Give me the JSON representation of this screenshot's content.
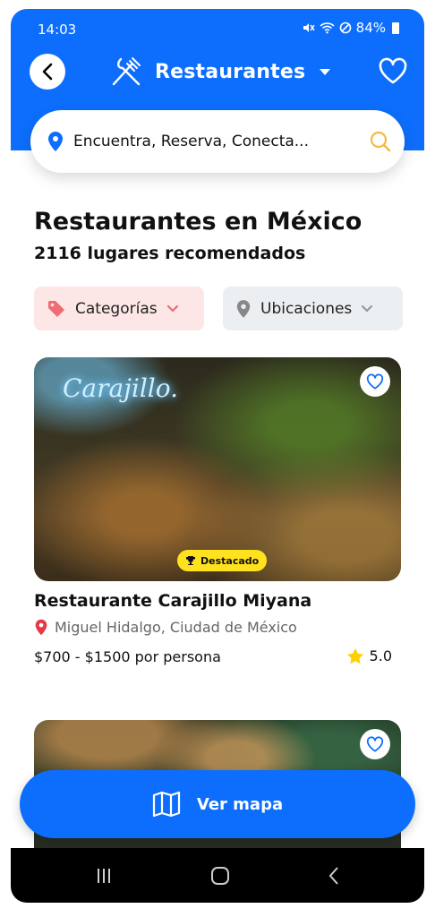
{
  "status": {
    "time": "14:03",
    "battery": "84%"
  },
  "header": {
    "title": "Restaurantes"
  },
  "search": {
    "text": "Encuentra, Reserva, Conecta..."
  },
  "heading": {
    "title": "Restaurantes en México",
    "subtitle": "2116 lugares recomendados"
  },
  "filters": {
    "categories": "Categorías",
    "locations": "Ubicaciones"
  },
  "cards": [
    {
      "sign_text": "Carajillo.",
      "badge": "Destacado",
      "name": "Restaurante Carajillo Miyana",
      "location": "Miguel Hidalgo, Ciudad de México",
      "price": "$700 - $1500 por persona",
      "rating": "5.0"
    }
  ],
  "map_button": {
    "label": "Ver mapa"
  },
  "colors": {
    "primary": "#0d6efd",
    "badge": "#ffe21f",
    "pin": "#e53945",
    "star": "#ffd000"
  }
}
